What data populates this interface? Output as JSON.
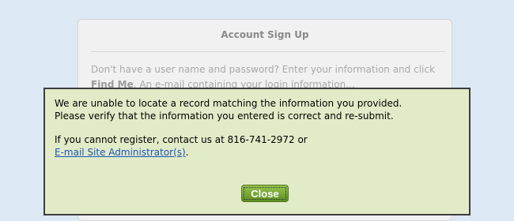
{
  "signup_card": {
    "title": "Account Sign Up",
    "body_part1": "Don't have a user name and password? Enter your information and click ",
    "body_bold": "Find Me",
    "body_part2": ". An e-mail containing your login information..."
  },
  "dialog": {
    "line1": "We are unable to locate a record matching the information you provided.",
    "line2": "Please verify that the information you entered is correct and re-submit.",
    "line3": "If you cannot register, contact us at 816-741-2972 or",
    "link_text": "E-mail Site Administrator(s)",
    "link_suffix": ".",
    "close_label": "Close"
  },
  "colors": {
    "page_background": "#dce8f4",
    "dialog_background": "#e2ebc8",
    "button_green": "#6f9f2c",
    "link_blue": "#1a55b8"
  }
}
